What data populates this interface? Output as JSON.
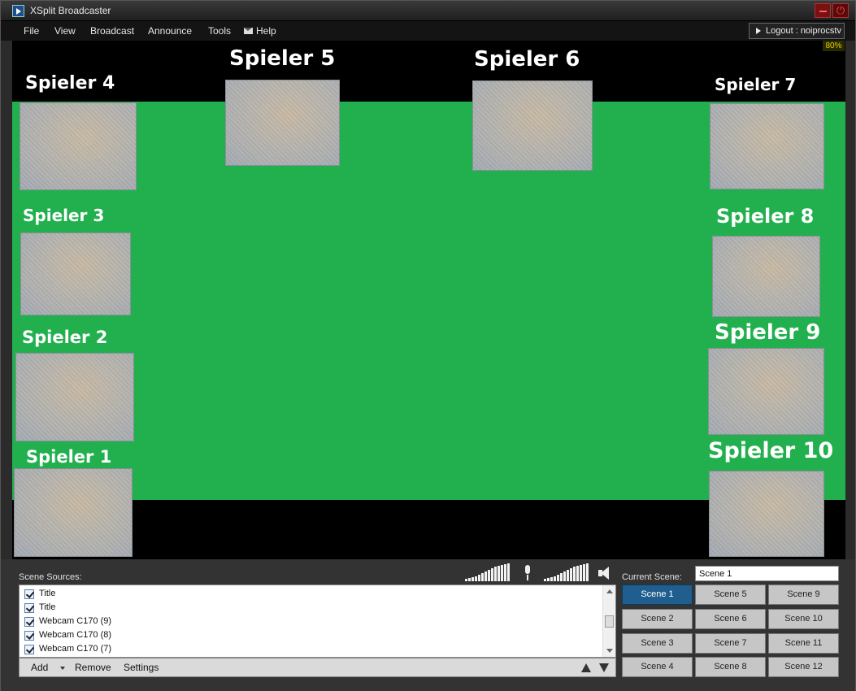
{
  "window": {
    "title": "XSplit Broadcaster"
  },
  "menu": {
    "items": [
      "File",
      "View",
      "Broadcast",
      "Announce",
      "Tools",
      "Help"
    ]
  },
  "logout_label": "Logout : noiprocstv",
  "zoom_level": "80%",
  "preview": {
    "players": [
      "Spieler 1",
      "Spieler 2",
      "Spieler 3",
      "Spieler 4",
      "Spieler 5",
      "Spieler 6",
      "Spieler 7",
      "Spieler 8",
      "Spieler 9",
      "Spieler 10"
    ],
    "stage_color": "#22b04f"
  },
  "sources": {
    "label": "Scene Sources:",
    "items": [
      {
        "name": "Title",
        "checked": true
      },
      {
        "name": "Title",
        "checked": true
      },
      {
        "name": "Webcam C170 (9)",
        "checked": true
      },
      {
        "name": "Webcam C170 (8)",
        "checked": true
      },
      {
        "name": "Webcam C170 (7)",
        "checked": true
      }
    ],
    "toolbar": {
      "add": "Add",
      "remove": "Remove",
      "settings": "Settings"
    }
  },
  "audio": {
    "mic_icon": "microphone-icon",
    "speaker_icon": "speaker-icon"
  },
  "scenes": {
    "current_label": "Current Scene:",
    "current_value": "Scene 1",
    "buttons": [
      "Scene 1",
      "Scene 2",
      "Scene 3",
      "Scene 4",
      "Scene 5",
      "Scene 6",
      "Scene 7",
      "Scene 8",
      "Scene 9",
      "Scene 10",
      "Scene 11",
      "Scene 12"
    ],
    "active": "Scene 1",
    "active_color": "#1f5e8e"
  }
}
